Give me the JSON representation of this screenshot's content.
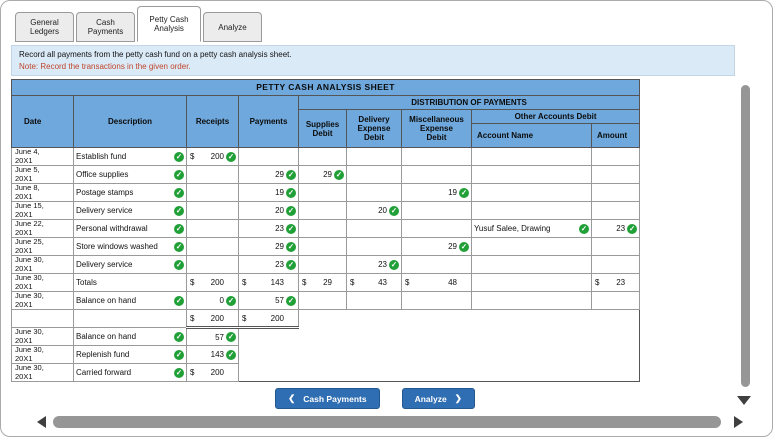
{
  "tabs": [
    {
      "label": "General Ledgers",
      "active": false
    },
    {
      "label": "Cash Payments",
      "active": false
    },
    {
      "label": "Petty Cash Analysis",
      "active": true
    },
    {
      "label": "Analyze",
      "active": false
    }
  ],
  "instructions": {
    "line1": "Record all payments from the petty cash fund on a petty cash analysis sheet.",
    "note": "Note: Record the transactions in the given order."
  },
  "sheet": {
    "title": "PETTY CASH ANALYSIS SHEET",
    "distribution_header": "DISTRIBUTION OF PAYMENTS",
    "other_accounts_header": "Other Accounts Debit",
    "columns": {
      "date": "Date",
      "description": "Description",
      "receipts": "Receipts",
      "payments": "Payments",
      "supplies": "Supplies\nDebit",
      "delivery": "Delivery\nExpense\nDebit",
      "misc": "Miscellaneous\nExpense\nDebit",
      "account": "Account Name",
      "amount": "Amount"
    },
    "rows": [
      {
        "date": "June 4,\n20X1",
        "description": {
          "text": "Establish fund",
          "check": true
        },
        "receipts": {
          "dollar": "$",
          "value": "200",
          "check": true
        }
      },
      {
        "date": "June 5,\n20X1",
        "description": {
          "text": "Office supplies",
          "check": true
        },
        "payments": {
          "value": "29",
          "check": true
        },
        "supplies": {
          "value": "29",
          "check": true
        }
      },
      {
        "date": "June 8,\n20X1",
        "description": {
          "text": "Postage stamps",
          "check": true
        },
        "payments": {
          "value": "19",
          "check": true
        },
        "misc": {
          "value": "19",
          "check": true
        }
      },
      {
        "date": "June 15,\n20X1",
        "description": {
          "text": "Delivery service",
          "check": true
        },
        "payments": {
          "value": "20",
          "check": true
        },
        "delivery": {
          "value": "20",
          "check": true
        }
      },
      {
        "date": "June 22,\n20X1",
        "description": {
          "text": "Personal withdrawal",
          "check": true
        },
        "payments": {
          "value": "23",
          "check": true
        },
        "account": {
          "text": "Yusuf Salee, Drawing",
          "check": true
        },
        "amount": {
          "value": "23",
          "check": true
        }
      },
      {
        "date": "June 25,\n20X1",
        "description": {
          "text": "Store windows washed",
          "check": true
        },
        "payments": {
          "value": "29",
          "check": true
        },
        "misc": {
          "value": "29",
          "check": true
        }
      },
      {
        "date": "June 30,\n20X1",
        "description": {
          "text": "Delivery service",
          "check": true
        },
        "payments": {
          "value": "23",
          "check": true
        },
        "delivery": {
          "value": "23",
          "check": true
        }
      },
      {
        "date": "June 30,\n20X1",
        "description": {
          "text": "Totals"
        },
        "receipts": {
          "dollar": "$",
          "value": "200"
        },
        "payments": {
          "dollar": "$",
          "value": "143"
        },
        "supplies": {
          "dollar": "$",
          "value": "29"
        },
        "delivery": {
          "dollar": "$",
          "value": "43"
        },
        "misc": {
          "dollar": "$",
          "value": "48"
        },
        "amount": {
          "dollar": "$",
          "value": "23"
        }
      },
      {
        "date": "June 30,\n20X1",
        "description": {
          "text": "Balance on hand",
          "check": true
        },
        "receipts": {
          "value": "0",
          "check": true
        },
        "payments": {
          "value": "57",
          "check": true
        }
      },
      {
        "date": "",
        "receipts": {
          "dollar": "$",
          "value": "200",
          "double": true
        },
        "payments": {
          "dollar": "$",
          "value": "200",
          "double": true
        },
        "open_from": "supplies"
      },
      {
        "date": "June 30,\n20X1",
        "description": {
          "text": "Balance on hand",
          "check": true
        },
        "receipts": {
          "value": "57",
          "check": true
        },
        "open_from": "payments"
      },
      {
        "date": "June 30,\n20X1",
        "description": {
          "text": "Replenish fund",
          "check": true
        },
        "receipts": {
          "value": "143",
          "check": true
        },
        "open_from": "payments"
      },
      {
        "date": "June 30,\n20X1",
        "description": {
          "text": "Carried forward",
          "check": true
        },
        "receipts": {
          "dollar": "$",
          "value": "200"
        },
        "open_from": "payments"
      }
    ]
  },
  "footer": {
    "back_label": "Cash Payments",
    "next_label": "Analyze"
  },
  "icons": {
    "check-icon": "✓",
    "chevron-left-icon": "❮",
    "chevron-right-icon": "❯"
  },
  "colors": {
    "accent": "#2f6eb2",
    "header_blue": "#6fa8dc",
    "check_green": "#21a038",
    "note_red": "#c0452b",
    "info_bg": "#dbeaf7"
  }
}
